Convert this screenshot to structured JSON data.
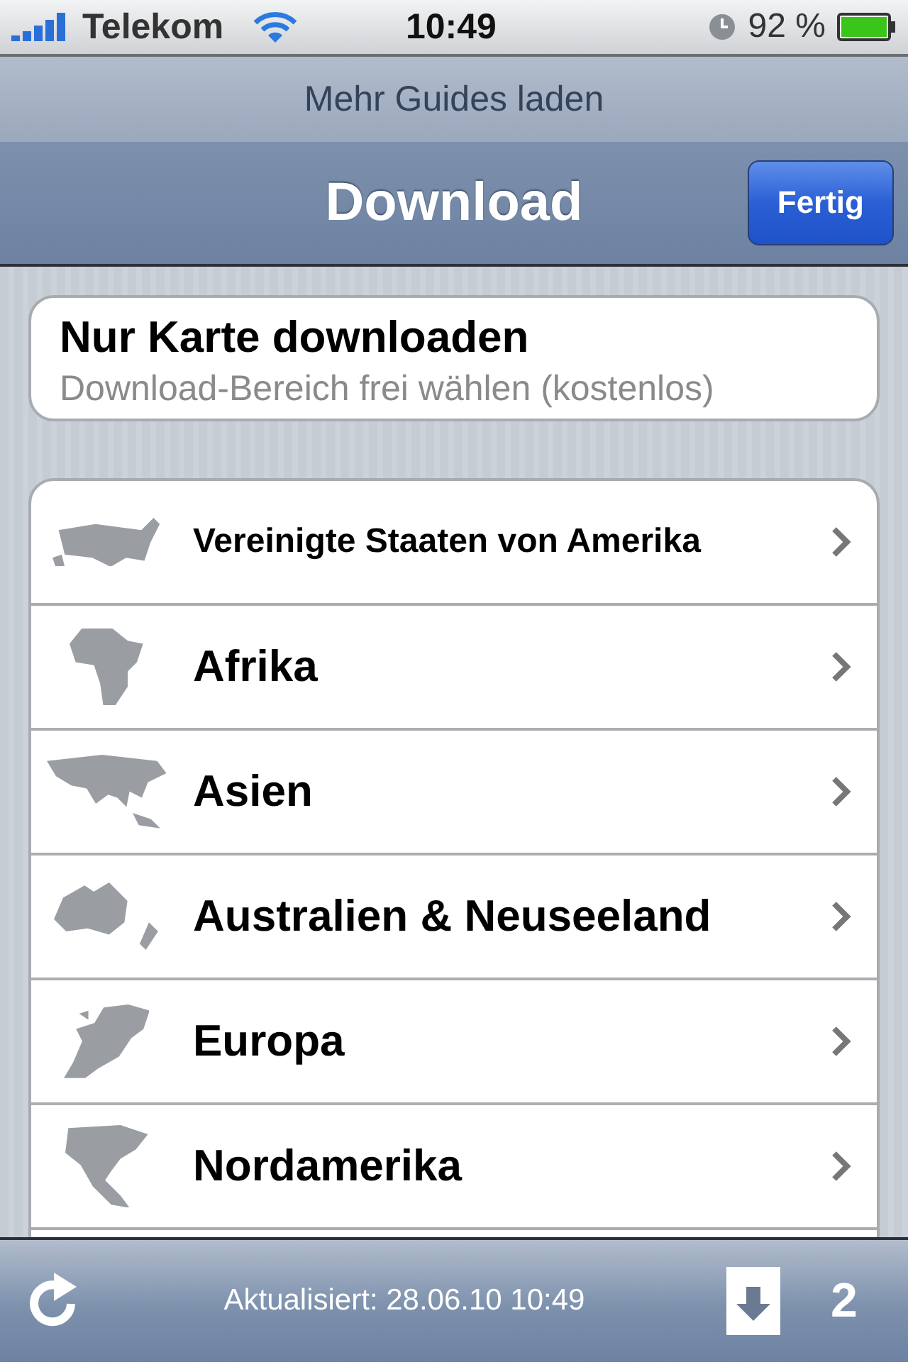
{
  "status_bar": {
    "carrier": "Telekom",
    "time": "10:49",
    "battery": "92 %"
  },
  "prompt": "Mehr Guides laden",
  "nav": {
    "title": "Download",
    "done_button": "Fertig"
  },
  "map_only": {
    "title": "Nur Karte downloaden",
    "subtitle": "Download-Bereich frei wählen (kostenlos)"
  },
  "regions": [
    {
      "name": "Vereinigte Staaten von Amerika"
    },
    {
      "name": "Afrika"
    },
    {
      "name": "Asien"
    },
    {
      "name": "Australien & Neuseeland"
    },
    {
      "name": "Europa"
    },
    {
      "name": "Nordamerika"
    }
  ],
  "toolbar": {
    "updated": "Aktualisiert: 28.06.10 10:49",
    "download_count": "2"
  }
}
